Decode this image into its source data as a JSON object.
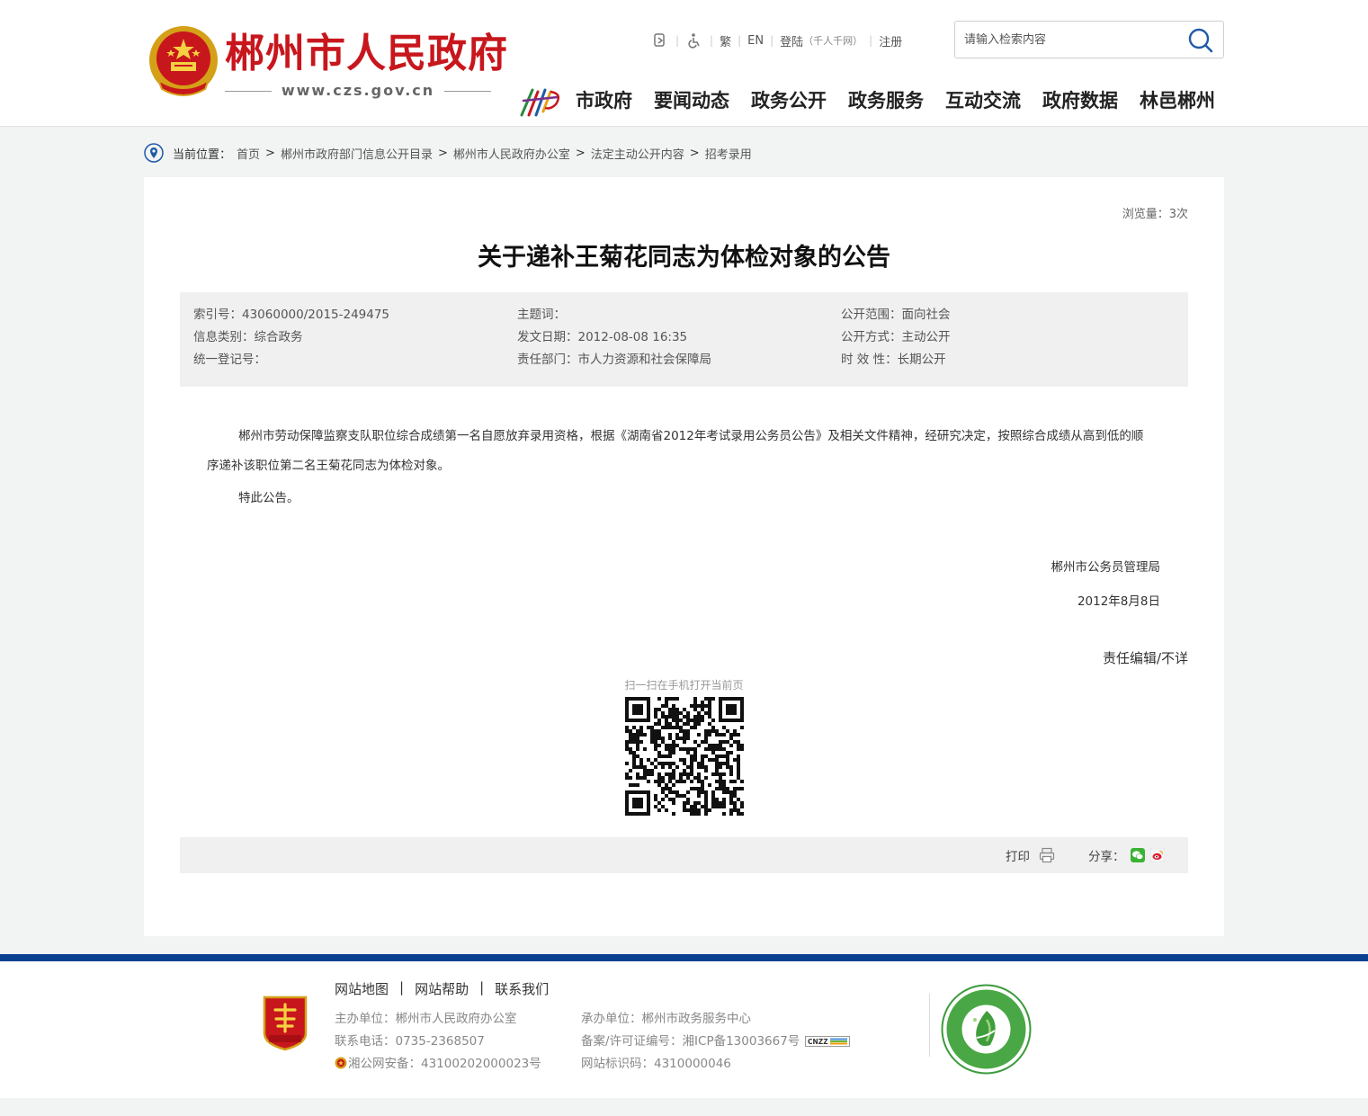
{
  "header": {
    "site_name": "郴州市人民政府",
    "site_url": "www.czs.gov.cn",
    "toplinks": {
      "trad": "繁",
      "en": "EN",
      "login": "登陆",
      "login_sub": "（千人千网）",
      "register": "注册"
    },
    "search": {
      "placeholder": "请输入检索内容"
    },
    "nav": [
      "市政府",
      "要闻动态",
      "政务公开",
      "政务服务",
      "互动交流",
      "政府数据",
      "林邑郴州"
    ]
  },
  "breadcrumb": {
    "label": "当前位置：",
    "items": [
      "首页",
      "郴州市政府部门信息公开目录",
      "郴州市人民政府办公室",
      "法定主动公开内容",
      "招考录用"
    ],
    "separator": ">"
  },
  "article": {
    "views": "浏览量：3次",
    "title": "关于递补王菊花同志为体检对象的公告",
    "meta": {
      "index_no": "索引号：43060000/2015-249475",
      "subject": "主题词：",
      "scope": "公开范围：面向社会",
      "category": "信息类别：综合政务",
      "date": "发文日期：2012-08-08 16:35",
      "method": "公开方式：主动公开",
      "reg_no": "统一登记号：",
      "dept": "责任部门：市人力资源和社会保障局",
      "validity": "时 效 性：长期公开"
    },
    "paragraphs": [
      "郴州市劳动保障监察支队职位综合成绩第一名自愿放弃录用资格，根据《湖南省2012年考试录用公务员公告》及相关文件精神，经研究决定，按照综合成绩从高到低的顺序递补该职位第二名王菊花同志为体检对象。",
      "特此公告。"
    ],
    "sign_org": "郴州市公务员管理局",
    "sign_date": "2012年8月8日",
    "editor": "责任编辑/不详",
    "qr_caption": "扫一扫在手机打开当前页",
    "print_label": "打印",
    "share_label": "分享："
  },
  "footer": {
    "links": [
      "网站地图",
      "网站帮助",
      "联系我们"
    ],
    "link_sep": "|",
    "host": "主办单位：郴州市人民政府办公室",
    "phone": "联系电话：0735-2368507",
    "police": "湘公网安备：43100202000023号",
    "operator": "承办单位：郴州市政务服务中心",
    "icp": "备案/许可证编号：湘ICP备13003667号",
    "site_id": "网站标识码：4310000046",
    "cnzz": "CNZZ"
  },
  "colors": {
    "brand_red": "#c8161d",
    "footer_blue": "#0b4090"
  }
}
